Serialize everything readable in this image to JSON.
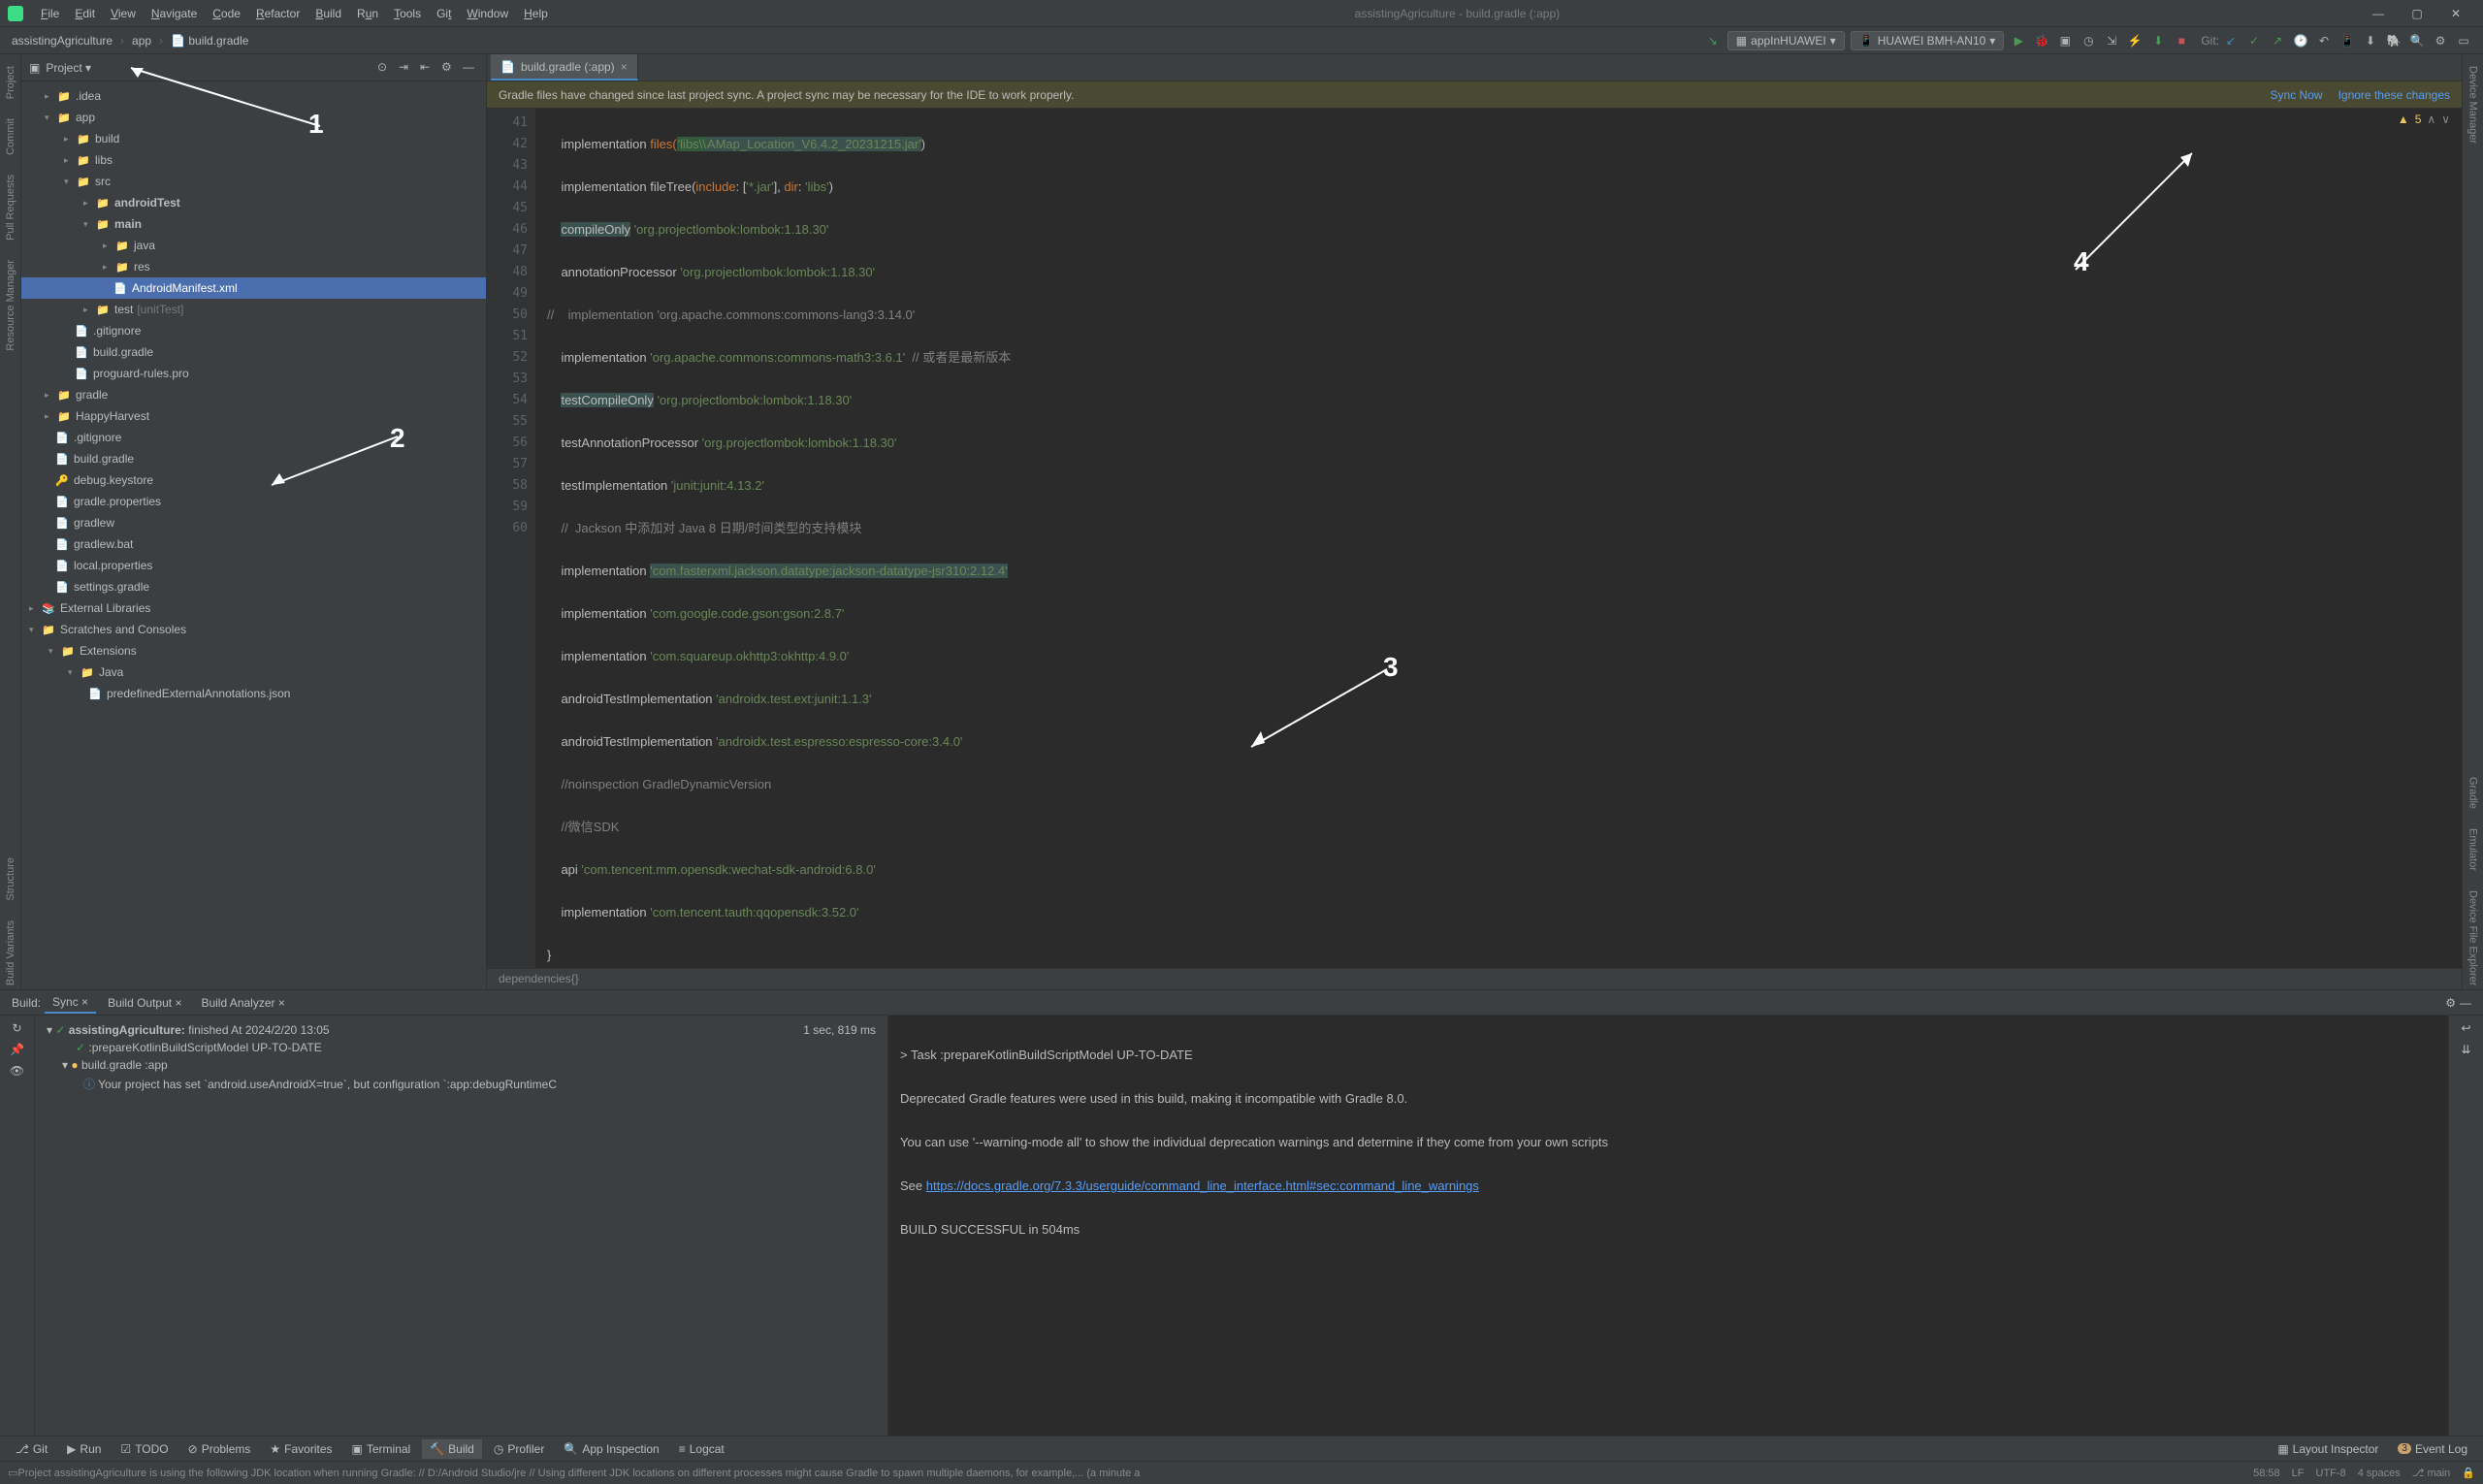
{
  "window": {
    "title": "assistingAgriculture - build.gradle (:app)"
  },
  "menu": [
    "File",
    "Edit",
    "View",
    "Navigate",
    "Code",
    "Refactor",
    "Build",
    "Run",
    "Tools",
    "Git",
    "Window",
    "Help"
  ],
  "breadcrumb": [
    "assistingAgriculture",
    "app",
    "build.gradle"
  ],
  "runConfig": "appInHUAWEI",
  "device": "HUAWEI BMH-AN10",
  "gitLabel": "Git:",
  "leftSide": {
    "project": "Project",
    "commit": "Commit",
    "pull": "Pull Requests",
    "resmgr": "Resource Manager",
    "struct": "Structure",
    "variants": "Build Variants"
  },
  "rightSide": {
    "devmgr": "Device Manager",
    "gradle": "Gradle",
    "emu": "Emulator",
    "devfile": "Device File Explorer"
  },
  "projectHeader": {
    "title": "Project"
  },
  "tree": {
    "idea": ".idea",
    "app": "app",
    "build": "build",
    "libs": "libs",
    "src": "src",
    "androidTest": "androidTest",
    "main": "main",
    "java": "java",
    "res": "res",
    "manifest": "AndroidManifest.xml",
    "test": "test",
    "testSuffix": "[unitTest]",
    "gitignore_app": ".gitignore",
    "buildgradle_app": "build.gradle",
    "proguard": "proguard-rules.pro",
    "gradle_dir": "gradle",
    "happy": "HappyHarvest",
    "gitignore_root": ".gitignore",
    "buildgradle_root": "build.gradle",
    "debugkey": "debug.keystore",
    "gradleprops": "gradle.properties",
    "gradlew": "gradlew",
    "gradlewbat": "gradlew.bat",
    "localprops": "local.properties",
    "settings": "settings.gradle",
    "extlibs": "External Libraries",
    "scratches": "Scratches and Consoles",
    "extensions": "Extensions",
    "java2": "Java",
    "predef": "predefinedExternalAnnotations.json"
  },
  "editor": {
    "tabName": "build.gradle (:app)",
    "notif": "Gradle files have changed since last project sync. A project sync may be necessary for the IDE to work properly.",
    "sync": "Sync Now",
    "ignore": "Ignore these changes",
    "warnCount": "5",
    "crumb": "dependencies{}"
  },
  "code": {
    "l41a": "implementation ",
    "l41b": "files(",
    "l41c": "'libs\\\\",
    "l41d": "AMap_Location_V6.4.2_20231215.jar'",
    "l41e": ")",
    "l42": "implementation fileTree(",
    "l42i": "include",
    "l42a": ": [",
    "l42s": "'*.jar'",
    "l42b": "], ",
    "l42d": "dir",
    "l42c": ": ",
    "l42s2": "'libs'",
    "l42end": ")",
    "l43a": "compileOnly",
    "l43b": " 'org.projectlombok:lombok:1.18.30'",
    "l44": "annotationProcessor ",
    "l44s": "'org.projectlombok:lombok:1.18.30'",
    "l45": "//    implementation 'org.apache.commons:commons-lang3:3.14.0'",
    "l46": "implementation ",
    "l46s": "'org.apache.commons:commons-math3:3.6.1'",
    "l46c": "  // 或者是最新版本",
    "l47a": "testCompileOnly",
    "l47b": " 'org.projectlombok:lombok:1.18.30'",
    "l48": "testAnnotationProcessor ",
    "l48s": "'org.projectlombok:lombok:1.18.30'",
    "l49": "testImplementation ",
    "l49s": "'junit:junit:4.13.2'",
    "l50": "//  Jackson 中添加对 Java 8 日期/时间类型的支持模块",
    "l51": "implementation ",
    "l51s": "'com.fasterxml.jackson.datatype:jackson-datatype-jsr310:2.12.4'",
    "l52": "implementation ",
    "l52s": "'com.google.code.gson:gson:2.8.7'",
    "l53": "implementation ",
    "l53s": "'com.squareup.okhttp3:okhttp:4.9.0'",
    "l54": "androidTestImplementation ",
    "l54s": "'androidx.test.ext:junit:1.1.3'",
    "l55": "androidTestImplementation ",
    "l55s": "'androidx.test.espresso:espresso-core:3.4.0'",
    "l56": "//noinspection GradleDynamicVersion",
    "l57": "//微信SDK",
    "l58": "api ",
    "l58s": "'com.tencent.mm.opensdk:wechat-sdk-android:6.8.0'",
    "l59": "implementation ",
    "l59s": "'com.tencent.tauth:qqopensdk:3.52.0'",
    "l60": "}"
  },
  "build": {
    "label": "Build:",
    "sync": "Sync",
    "output": "Build Output",
    "analyzer": "Build Analyzer",
    "root": "assistingAgriculture:",
    "rootSuffix": " finished",
    "rootTime": " At 2024/2/20 13:05",
    "dur": "1 sec, 819 ms",
    "task": ":prepareKotlinBuildScriptModel",
    "taskSt": " UP-TO-DATE",
    "gradlefile": "build.gradle ",
    "gradleMod": ":app",
    "diag": "Your project has set `android.useAndroidX=true`, but configuration `:app:debugRuntimeC",
    "out1": "> Task :prepareKotlinBuildScriptModel UP-TO-DATE",
    "out2": "Deprecated Gradle features were used in this build, making it incompatible with Gradle 8.0.",
    "out3": "You can use '--warning-mode all' to show the individual deprecation warnings and determine if they come from your own scripts",
    "out4": "See ",
    "outLink": "https://docs.gradle.org/7.3.3/userguide/command_line_interface.html#sec:command_line_warnings",
    "out5": "BUILD SUCCESSFUL in 504ms"
  },
  "bottom": {
    "git": "Git",
    "run": "Run",
    "todo": "TODO",
    "problems": "Problems",
    "fav": "Favorites",
    "term": "Terminal",
    "build": "Build",
    "prof": "Profiler",
    "appinsp": "App Inspection",
    "logcat": "Logcat",
    "layout": "Layout Inspector",
    "event": "Event Log",
    "eventN": "3"
  },
  "status": {
    "msg": "Project assistingAgriculture is using the following JDK location when running Gradle: // D:/Android Studio/jre // Using different JDK locations on different processes might cause Gradle to spawn multiple daemons, for example,... (a minute a",
    "pos": "58:58",
    "lf": "LF",
    "enc": "UTF-8",
    "indent": "4 spaces"
  },
  "annot": {
    "a1": "1",
    "a2": "2",
    "a3": "3",
    "a4": "4"
  }
}
